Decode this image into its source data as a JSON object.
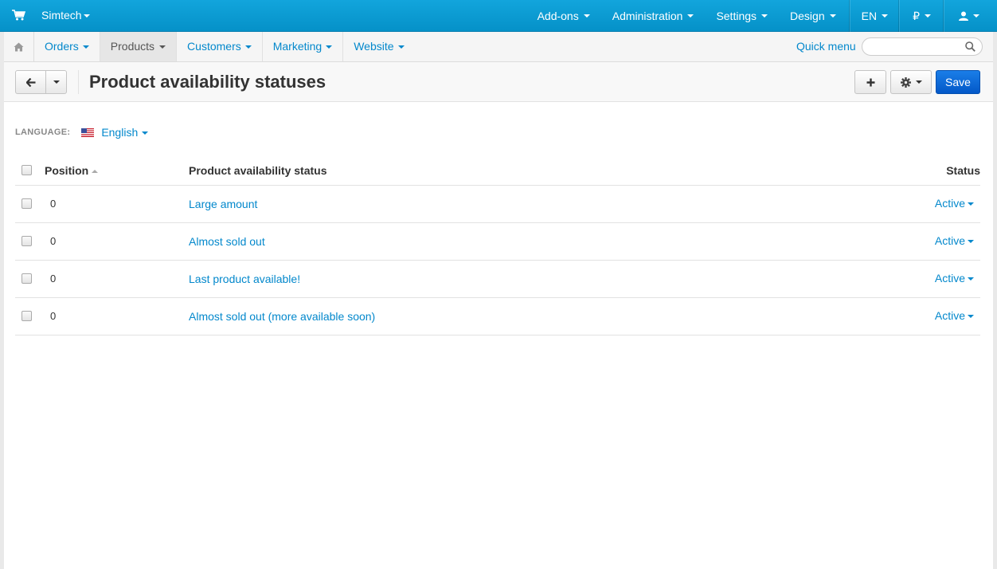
{
  "topbar": {
    "brand": "Simtech",
    "menus": [
      {
        "label": "Add-ons"
      },
      {
        "label": "Administration"
      },
      {
        "label": "Settings"
      },
      {
        "label": "Design"
      }
    ],
    "language": "EN",
    "currency": "₽"
  },
  "subnav": {
    "items": [
      {
        "label": "Orders"
      },
      {
        "label": "Products"
      },
      {
        "label": "Customers"
      },
      {
        "label": "Marketing"
      },
      {
        "label": "Website"
      }
    ],
    "quick_menu": "Quick menu",
    "search_placeholder": ""
  },
  "page": {
    "title": "Product availability statuses",
    "save_label": "Save"
  },
  "language_selector": {
    "label": "LANGUAGE:",
    "value": "English"
  },
  "table": {
    "headers": {
      "position": "Position",
      "name": "Product availability status",
      "status": "Status"
    },
    "rows": [
      {
        "position": "0",
        "name": "Large amount",
        "status": "Active"
      },
      {
        "position": "0",
        "name": "Almost sold out",
        "status": "Active"
      },
      {
        "position": "0",
        "name": "Last product available!",
        "status": "Active"
      },
      {
        "position": "0",
        "name": "Almost sold out (more available soon)",
        "status": "Active"
      }
    ]
  },
  "colors": {
    "topbar": "#0a9ad4",
    "link": "#0388cc",
    "save_button": "#0b6ad8"
  },
  "icons": [
    "cart-icon",
    "home-icon",
    "search-icon",
    "arrow-left-icon",
    "plus-icon",
    "gear-icon",
    "user-icon",
    "us-flag-icon"
  ]
}
